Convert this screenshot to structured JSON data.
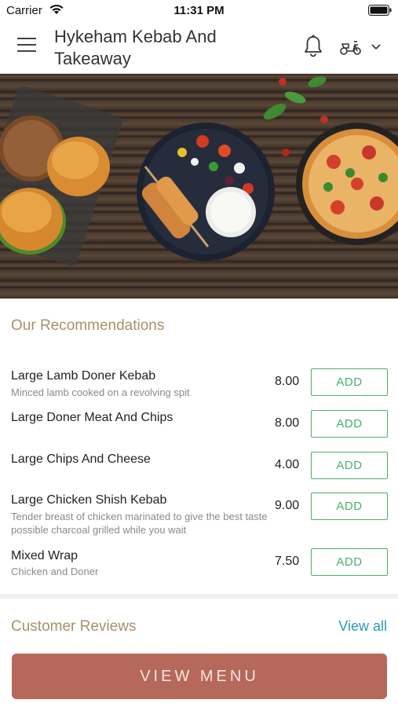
{
  "status_bar": {
    "carrier": "Carrier",
    "time": "11:31 PM"
  },
  "header": {
    "title": "Hykeham Kebab And Takeaway"
  },
  "recommendations": {
    "title": "Our Recommendations",
    "items": [
      {
        "name": "Large Lamb Doner Kebab",
        "description": "Minced lamb cooked on a revolving spit",
        "price": "8.00",
        "button": "ADD"
      },
      {
        "name": "Large Doner Meat And Chips",
        "description": "",
        "price": "8.00",
        "button": "ADD"
      },
      {
        "name": "Large Chips And Cheese",
        "description": "",
        "price": "4.00",
        "button": "ADD"
      },
      {
        "name": "Large Chicken Shish Kebab",
        "description": "Tender breast of chicken marinated to give the best taste possible charcoal grilled while you wait",
        "price": "9.00",
        "button": "ADD"
      },
      {
        "name": "Mixed Wrap",
        "description": "Chicken and Doner",
        "price": "7.50",
        "button": "ADD"
      }
    ]
  },
  "reviews": {
    "title": "Customer Reviews",
    "view_all": "View all"
  },
  "footer": {
    "view_menu": "VIEW MENU"
  },
  "colors": {
    "accent_gold": "#a8916b",
    "add_green": "#4caf6a",
    "link_blue": "#2a9bb8",
    "cta_terracotta": "#b6685a"
  },
  "icons": [
    "wifi-icon",
    "battery-icon",
    "hamburger-menu-icon",
    "bell-icon",
    "scooter-icon",
    "chevron-down-icon"
  ]
}
